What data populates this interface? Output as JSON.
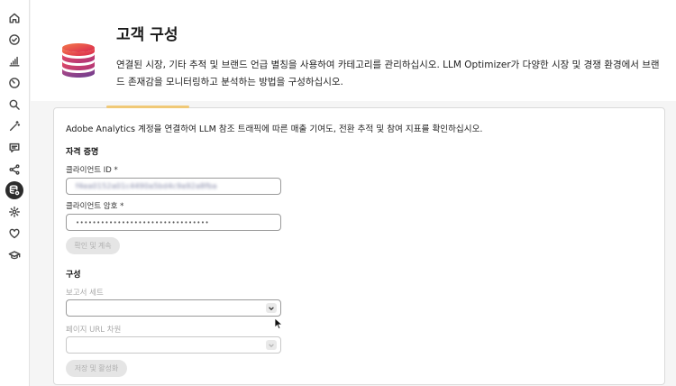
{
  "page": {
    "title": "고객 구성",
    "description": "연결된 시장, 기타 추적 및 브랜드 언급 별칭을 사용하여 카테고리를 관리하십시오. LLM Optimizer가 다양한 시장 및 경쟁 환경에서 브랜드 존재감을 모니터링하고 분석하는 방법을 구성하십시오."
  },
  "sidebar": {
    "icons": [
      "home-icon",
      "check-circle-icon",
      "bar-chart-icon",
      "gauge-icon",
      "search-icon",
      "magic-wand-icon",
      "chat-icon",
      "share-icon",
      "database-gear-icon",
      "settings-icon",
      "heart-icon",
      "graduation-cap-icon"
    ],
    "active": "database-gear-icon"
  },
  "card": {
    "intro": "Adobe Analytics 계정을 연결하여 LLM 참조 트래픽에 따른 매출 기여도, 전환 추적 및 참여 지표를 확인하십시오.",
    "credentials": {
      "heading": "자격 증명",
      "client_id_label": "클라이언트 ID *",
      "client_id_value": "f4ea0152a01c4490a5bd4c9a92a8fba",
      "client_secret_label": "클라이언트 암호 *",
      "client_secret_value": "••••••••••••••••••••••••••••••••",
      "confirm_button": "확인 및 계속"
    },
    "configuration": {
      "heading": "구성",
      "report_suite_label": "보고서 세트",
      "report_suite_value": "",
      "page_url_label": "페이지 URL 차원",
      "page_url_value": "",
      "save_button": "저장 및 활성화"
    }
  }
}
